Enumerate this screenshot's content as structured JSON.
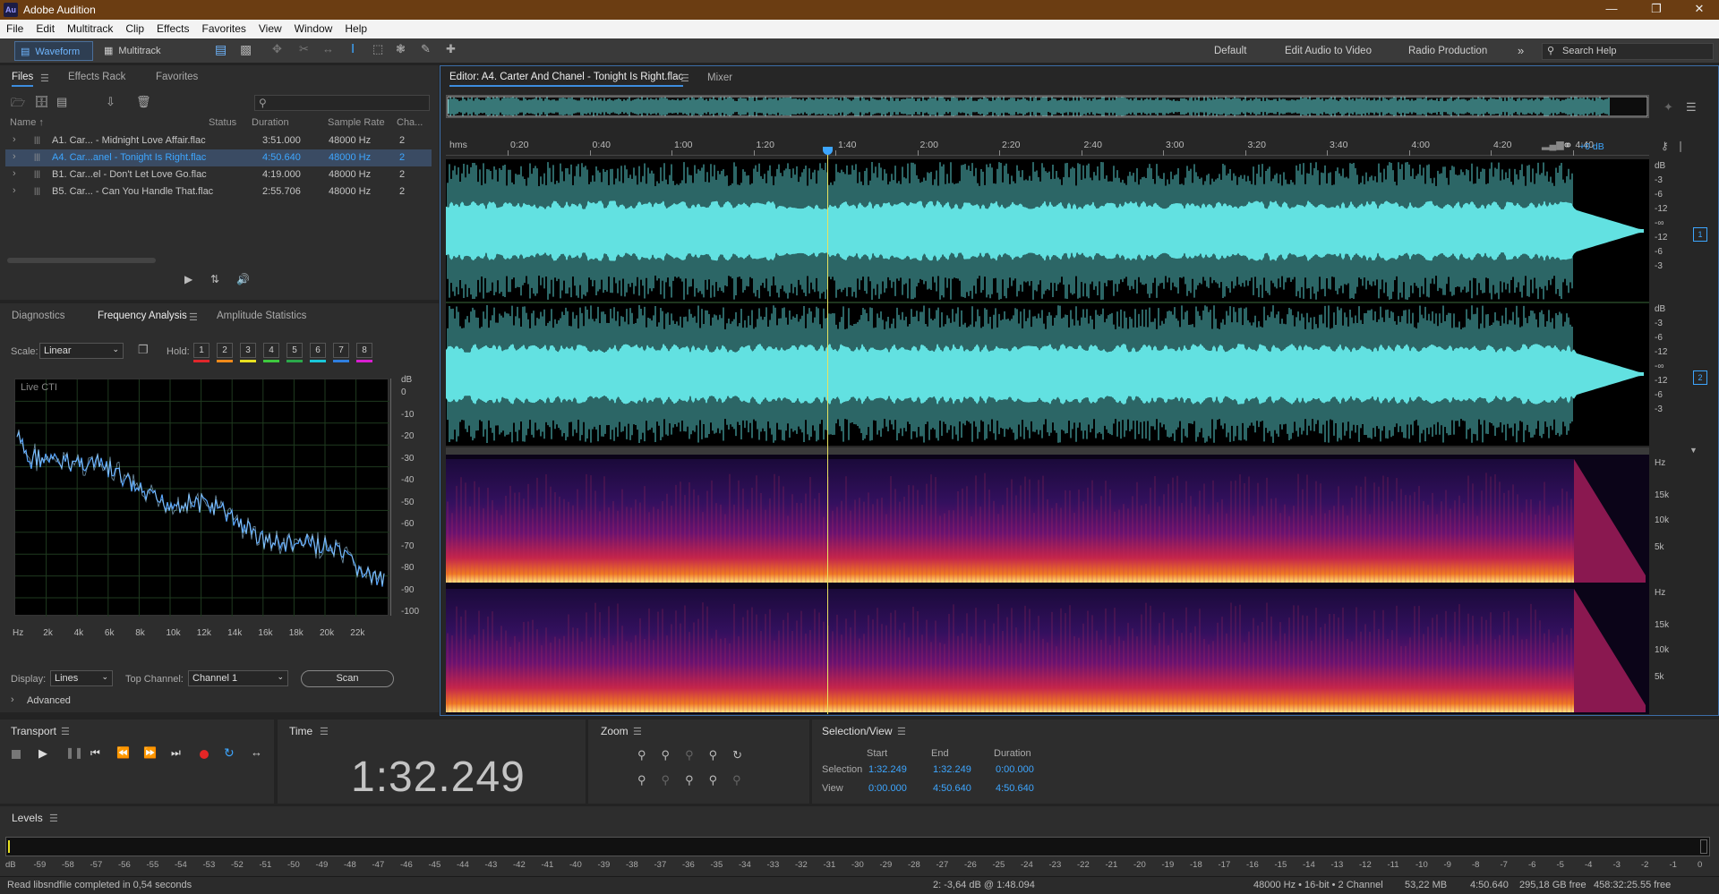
{
  "app": {
    "title": "Adobe Audition",
    "logo": "Au",
    "window_controls": [
      "minimize-icon",
      "restore-icon",
      "close-icon"
    ]
  },
  "menu": [
    "File",
    "Edit",
    "Multitrack",
    "Clip",
    "Effects",
    "Favorites",
    "View",
    "Window",
    "Help"
  ],
  "toolbar": {
    "waveform": "Waveform",
    "multitrack": "Multitrack",
    "workspaces": [
      "Default",
      "Edit Audio to Video",
      "Radio Production"
    ],
    "search_placeholder": "Search Help"
  },
  "files_panel": {
    "tabs": [
      "Files",
      "Effects Rack",
      "Favorites"
    ],
    "columns": [
      "Name ↑",
      "Status",
      "Duration",
      "Sample Rate",
      "Cha..."
    ],
    "rows": [
      {
        "name": "A1. Car... - Midnight Love Affair.flac",
        "duration": "3:51.000",
        "rate": "48000 Hz",
        "ch": "2"
      },
      {
        "name": "A4. Car...anel - Tonight Is Right.flac",
        "duration": "4:50.640",
        "rate": "48000 Hz",
        "ch": "2"
      },
      {
        "name": "B1. Car...el - Don't Let Love Go.flac",
        "duration": "4:19.000",
        "rate": "48000 Hz",
        "ch": "2"
      },
      {
        "name": "B5. Car... - Can You Handle That.flac",
        "duration": "2:55.706",
        "rate": "48000 Hz",
        "ch": "2"
      }
    ],
    "selected_index": 1
  },
  "analysis_panel": {
    "tabs": [
      "Diagnostics",
      "Frequency Analysis",
      "Amplitude Statistics"
    ],
    "scale_label": "Scale:",
    "scale_value": "Linear",
    "hold_label": "Hold:",
    "hold": [
      {
        "n": "1",
        "color": "#e0262b"
      },
      {
        "n": "2",
        "color": "#f08a1a"
      },
      {
        "n": "3",
        "color": "#e8e020"
      },
      {
        "n": "4",
        "color": "#3ec93e"
      },
      {
        "n": "5",
        "color": "#2aa84a"
      },
      {
        "n": "6",
        "color": "#19c6d8"
      },
      {
        "n": "7",
        "color": "#2f7fe0"
      },
      {
        "n": "8",
        "color": "#d81fd0"
      }
    ],
    "graph_label": "Live CTI",
    "db_label": "dB",
    "db_ticks": [
      "0",
      "-10",
      "-20",
      "-30",
      "-40",
      "-50",
      "-60",
      "-70",
      "-80",
      "-90",
      "-100"
    ],
    "hz_ticks": [
      "Hz",
      "2k",
      "4k",
      "6k",
      "8k",
      "10k",
      "12k",
      "14k",
      "16k",
      "18k",
      "20k",
      "22k"
    ],
    "display_label": "Display:",
    "display_value": "Lines",
    "top_channel_label": "Top Channel:",
    "top_channel_value": "Channel 1",
    "scan": "Scan",
    "advanced": "Advanced"
  },
  "editor": {
    "tab": "Editor: A4. Carter And Chanel - Tonight Is Right.flac",
    "mixer": "Mixer",
    "ruler": [
      "hms",
      "0:20",
      "0:40",
      "1:00",
      "1:20",
      "1:40",
      "2:00",
      "2:20",
      "2:40",
      "3:00",
      "3:20",
      "3:40",
      "4:00",
      "4:20",
      "4:40"
    ],
    "gain": "+0 dB",
    "db_ticks_ch": [
      "dB",
      "-3",
      "-6",
      "-12",
      "-∞",
      "-12",
      "-6",
      "-3"
    ],
    "channels": [
      "1",
      "2"
    ],
    "hz_ticks": [
      "Hz",
      "15k",
      "10k",
      "5k"
    ],
    "playhead_fraction": 0.3166,
    "colors": {
      "wave": "#62e1e1",
      "wave_bg": "#000000",
      "accent": "#3d8dde"
    }
  },
  "transport": {
    "title": "Transport"
  },
  "time": {
    "title": "Time",
    "value": "1:32.249"
  },
  "zoom": {
    "title": "Zoom"
  },
  "selection": {
    "title": "Selection/View",
    "cols": [
      "Start",
      "End",
      "Duration"
    ],
    "rows": [
      {
        "label": "Selection",
        "start": "1:32.249",
        "end": "1:32.249",
        "duration": "0:00.000"
      },
      {
        "label": "View",
        "start": "0:00.000",
        "end": "4:50.640",
        "duration": "4:50.640"
      }
    ]
  },
  "levels": {
    "title": "Levels",
    "ticks": [
      "dB",
      "-59",
      "-58",
      "-57",
      "-56",
      "-55",
      "-54",
      "-53",
      "-52",
      "-51",
      "-50",
      "-49",
      "-48",
      "-47",
      "-46",
      "-45",
      "-44",
      "-43",
      "-42",
      "-41",
      "-40",
      "-39",
      "-38",
      "-37",
      "-36",
      "-35",
      "-34",
      "-33",
      "-32",
      "-31",
      "-30",
      "-29",
      "-28",
      "-27",
      "-26",
      "-25",
      "-24",
      "-23",
      "-22",
      "-21",
      "-20",
      "-19",
      "-18",
      "-17",
      "-16",
      "-15",
      "-14",
      "-13",
      "-12",
      "-11",
      "-10",
      "-9",
      "-8",
      "-7",
      "-6",
      "-5",
      "-4",
      "-3",
      "-2",
      "-1",
      "0"
    ]
  },
  "status": {
    "left": "Read libsndfile completed in 0,54 seconds",
    "cursor": "2: -3,64 dB @ 1:48.094",
    "format": "48000 Hz • 16-bit • 2 Channel",
    "size": "53,22 MB",
    "duration": "4:50.640",
    "free": "295,18 GB free",
    "time_free": "458:32:25.55 free"
  }
}
